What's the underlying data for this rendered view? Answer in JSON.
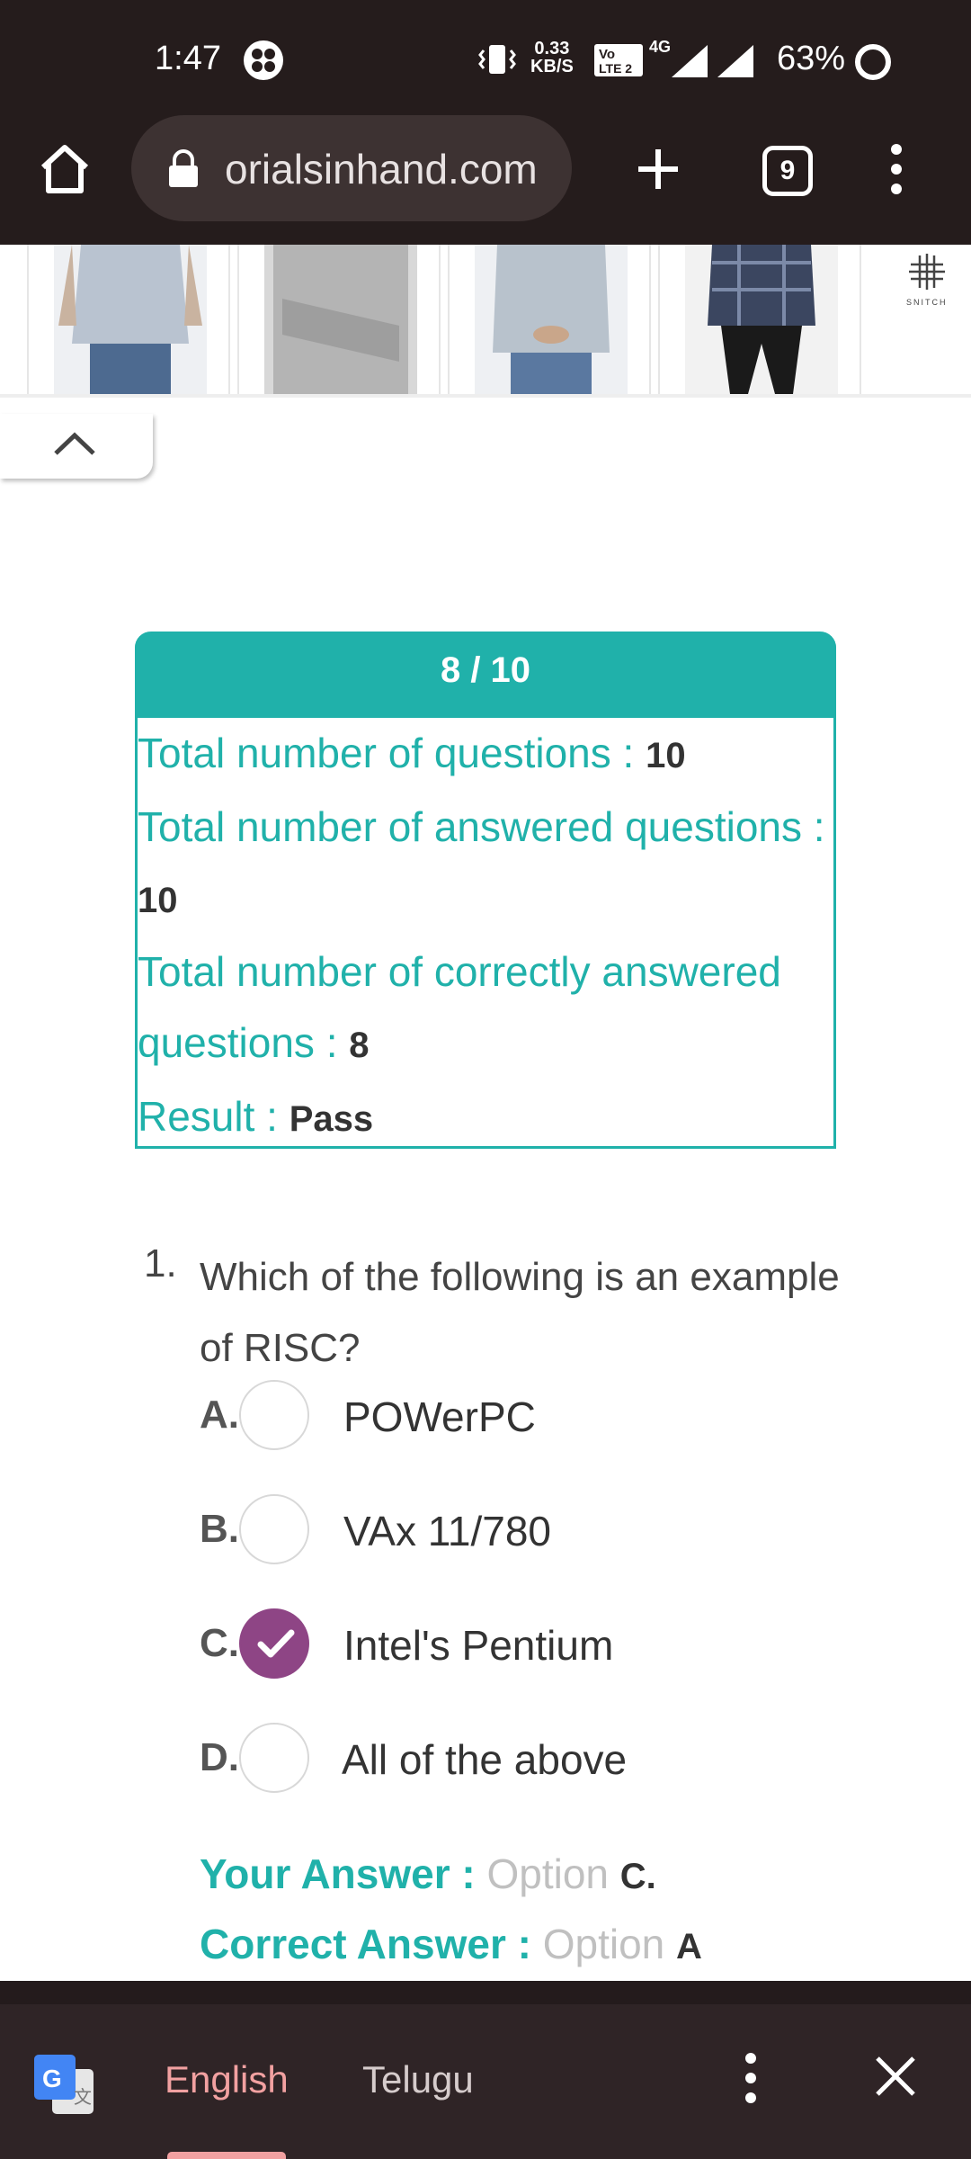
{
  "status_bar": {
    "time": "1:47",
    "speed_value": "0.33",
    "speed_unit": "KB/S",
    "volte_line1": "Vo",
    "volte_line2": "LTE 2",
    "network": "4G",
    "battery": "63%",
    "icons": [
      "app-notification-icon",
      "vibrate-icon",
      "signal-icon",
      "battery-icon"
    ]
  },
  "browser": {
    "url": "orialsinhand.com",
    "tab_count": "9",
    "icons": [
      "home-icon",
      "lock-icon",
      "plus-icon",
      "more-vert-icon"
    ]
  },
  "ad": {
    "brand_text": "SNITCH",
    "items": [
      "shirt-photo-1",
      "shirt-photo-2",
      "shirt-photo-3",
      "shirt-photo-4"
    ]
  },
  "result": {
    "score": "8 / 10",
    "total_label": "Total number of questions : ",
    "total_value": "10",
    "answered_label": "Total number of answered questions : ",
    "answered_value": "10",
    "correct_label": "Total number of correctly answered questions : ",
    "correct_value": "8",
    "result_label": "Result : ",
    "result_value": "Pass"
  },
  "question": {
    "number": "1.",
    "text": "Which of the following is an example of RISC?",
    "options": [
      {
        "letter": "A.",
        "label": "POWerPC",
        "checked": false
      },
      {
        "letter": "B.",
        "label": "VAx 11/780",
        "checked": false
      },
      {
        "letter": "C.",
        "label": "Intel's Pentium",
        "checked": true
      },
      {
        "letter": "D.",
        "label": "All of the above",
        "checked": false
      }
    ],
    "your_answer_label": "Your Answer : ",
    "your_answer_prefix": "Option ",
    "your_answer_value": "C.",
    "correct_answer_label": "Correct Answer : ",
    "correct_answer_prefix": "Option ",
    "correct_answer_value": "A"
  },
  "translate": {
    "lang_selected": "English",
    "lang_other": "Telugu"
  },
  "colors": {
    "teal": "#20b1aa",
    "purple": "#8e4585",
    "dark_bar": "#251c1c",
    "pink_accent": "#f2a1a1"
  }
}
